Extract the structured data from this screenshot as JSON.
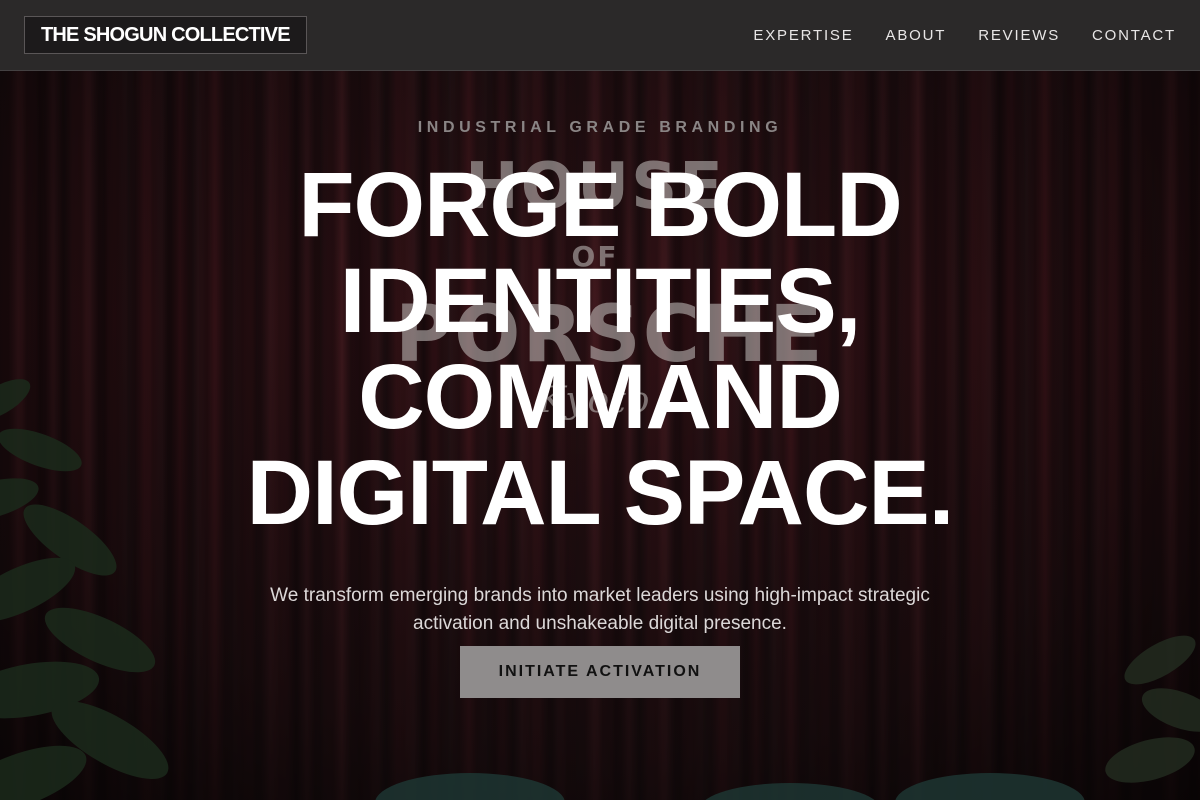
{
  "header": {
    "logo_text": "THE SHOGUN COLLECTIVE",
    "nav": [
      {
        "label": "EXPERTISE"
      },
      {
        "label": "ABOUT"
      },
      {
        "label": "REVIEWS"
      },
      {
        "label": "CONTACT"
      }
    ]
  },
  "hero": {
    "eyebrow": "INDUSTRIAL GRADE BRANDING",
    "headline_lines": [
      "FORGE BOLD",
      "IDENTITIES,",
      "COMMAND",
      "DIGITAL SPACE."
    ],
    "subtitle": "We transform emerging brands into market leaders using high-impact strategic activation and unshakeable digital presence.",
    "cta_label": "INITIATE ACTIVATION"
  },
  "background": {
    "sign_lines": [
      "HOUSE",
      "OF",
      "PORSCHE",
      "Kyoto"
    ]
  },
  "colors": {
    "header_bg": "#2b2929",
    "curtain": "#4a141b",
    "cta_bg": "#8f8c8c",
    "headline": "#ffffff",
    "eyebrow": "#8a8585"
  },
  "icons": [
    "logo-wordmark",
    "curtain-background",
    "plant-decoration"
  ]
}
